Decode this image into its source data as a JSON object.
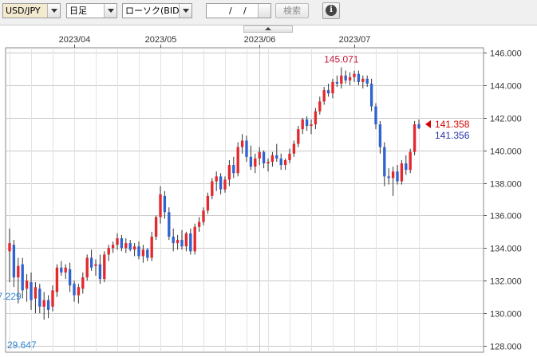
{
  "toolbar": {
    "symbol": "USD/JPY",
    "period": "日足",
    "chart_type": "ローソク(BID)",
    "date_month_sep": "/",
    "date_day_sep": "/",
    "search_label": "検索",
    "info_icon": "info-icon",
    "info_glyph": "i"
  },
  "colors": {
    "up": "#e3292e",
    "down": "#2f63d0",
    "wick": "#333333",
    "grid": "#c9c9c9",
    "high_label": "#c8193c",
    "low_label": "#2f86d1",
    "last_bid": "#d40000",
    "last_ask": "#2533a8"
  },
  "chart_data": {
    "type": "candlestick",
    "x_tick_labels": [
      "2023/04",
      "2023/05",
      "2023/06",
      "2023/07"
    ],
    "x_tick_dates": [
      "2023-04-03",
      "2023-05-01",
      "2023-06-01",
      "2023-07-03"
    ],
    "y_tick_labels": [
      "146.000",
      "144.000",
      "142.000",
      "140.000",
      "138.000",
      "136.000",
      "134.000",
      "132.000",
      "130.000",
      "128.000"
    ],
    "ylim": [
      127.6,
      146.3
    ],
    "grid": true,
    "candles": [
      {
        "o": 133.8,
        "h": 135.2,
        "l": 131.9,
        "c": 134.3
      },
      {
        "o": 134.2,
        "h": 134.5,
        "l": 131.6,
        "c": 132.2
      },
      {
        "o": 132.2,
        "h": 133.4,
        "l": 130.6,
        "c": 132.9
      },
      {
        "o": 133.0,
        "h": 133.4,
        "l": 130.9,
        "c": 131.4
      },
      {
        "o": 131.5,
        "h": 132.4,
        "l": 130.7,
        "c": 132.0
      },
      {
        "o": 131.9,
        "h": 132.5,
        "l": 130.2,
        "c": 130.8
      },
      {
        "o": 130.9,
        "h": 131.9,
        "l": 130.0,
        "c": 131.6
      },
      {
        "o": 131.5,
        "h": 131.8,
        "l": 130.0,
        "c": 130.4
      },
      {
        "o": 130.4,
        "h": 131.3,
        "l": 129.6,
        "c": 130.8
      },
      {
        "o": 130.8,
        "h": 131.1,
        "l": 129.7,
        "c": 130.2
      },
      {
        "o": 130.4,
        "h": 131.7,
        "l": 130.1,
        "c": 131.4
      },
      {
        "o": 131.3,
        "h": 133.0,
        "l": 131.0,
        "c": 132.8
      },
      {
        "o": 132.8,
        "h": 133.2,
        "l": 132.3,
        "c": 132.5
      },
      {
        "o": 132.5,
        "h": 133.0,
        "l": 132.1,
        "c": 132.8
      },
      {
        "o": 132.7,
        "h": 133.1,
        "l": 131.3,
        "c": 131.7
      },
      {
        "o": 131.8,
        "h": 132.0,
        "l": 130.7,
        "c": 131.1
      },
      {
        "o": 131.1,
        "h": 131.8,
        "l": 130.6,
        "c": 131.6
      },
      {
        "o": 131.5,
        "h": 132.5,
        "l": 131.2,
        "c": 132.2
      },
      {
        "o": 132.2,
        "h": 133.6,
        "l": 132.0,
        "c": 133.4
      },
      {
        "o": 133.4,
        "h": 133.9,
        "l": 132.6,
        "c": 132.8
      },
      {
        "o": 132.9,
        "h": 133.3,
        "l": 132.3,
        "c": 133.0
      },
      {
        "o": 133.0,
        "h": 133.6,
        "l": 131.8,
        "c": 132.1
      },
      {
        "o": 132.1,
        "h": 133.8,
        "l": 131.9,
        "c": 133.6
      },
      {
        "o": 133.6,
        "h": 134.2,
        "l": 133.2,
        "c": 134.0
      },
      {
        "o": 134.0,
        "h": 134.4,
        "l": 133.7,
        "c": 134.2
      },
      {
        "o": 134.2,
        "h": 134.9,
        "l": 133.9,
        "c": 134.6
      },
      {
        "o": 134.6,
        "h": 134.8,
        "l": 133.8,
        "c": 134.0
      },
      {
        "o": 134.0,
        "h": 134.6,
        "l": 133.7,
        "c": 134.3
      },
      {
        "o": 134.3,
        "h": 134.5,
        "l": 133.8,
        "c": 133.9
      },
      {
        "o": 133.9,
        "h": 134.3,
        "l": 133.5,
        "c": 134.1
      },
      {
        "o": 134.1,
        "h": 134.4,
        "l": 133.3,
        "c": 133.5
      },
      {
        "o": 133.5,
        "h": 134.2,
        "l": 133.1,
        "c": 133.9
      },
      {
        "o": 133.9,
        "h": 134.0,
        "l": 133.2,
        "c": 133.4
      },
      {
        "o": 133.4,
        "h": 135.0,
        "l": 133.2,
        "c": 134.7
      },
      {
        "o": 134.7,
        "h": 136.0,
        "l": 134.5,
        "c": 135.9
      },
      {
        "o": 135.9,
        "h": 137.8,
        "l": 135.5,
        "c": 137.3
      },
      {
        "o": 137.2,
        "h": 137.5,
        "l": 135.8,
        "c": 136.2
      },
      {
        "o": 136.2,
        "h": 136.5,
        "l": 134.5,
        "c": 134.7
      },
      {
        "o": 134.7,
        "h": 135.2,
        "l": 133.8,
        "c": 134.3
      },
      {
        "o": 134.3,
        "h": 134.8,
        "l": 133.9,
        "c": 134.5
      },
      {
        "o": 134.5,
        "h": 135.1,
        "l": 133.9,
        "c": 134.1
      },
      {
        "o": 134.1,
        "h": 135.0,
        "l": 133.8,
        "c": 134.9
      },
      {
        "o": 134.9,
        "h": 135.2,
        "l": 133.6,
        "c": 133.8
      },
      {
        "o": 133.8,
        "h": 135.5,
        "l": 133.6,
        "c": 135.3
      },
      {
        "o": 135.3,
        "h": 135.9,
        "l": 135.0,
        "c": 135.6
      },
      {
        "o": 135.6,
        "h": 136.5,
        "l": 135.4,
        "c": 136.3
      },
      {
        "o": 136.3,
        "h": 137.4,
        "l": 136.1,
        "c": 137.2
      },
      {
        "o": 137.2,
        "h": 138.3,
        "l": 137.0,
        "c": 138.1
      },
      {
        "o": 138.1,
        "h": 138.7,
        "l": 137.5,
        "c": 138.4
      },
      {
        "o": 138.4,
        "h": 138.6,
        "l": 137.3,
        "c": 137.6
      },
      {
        "o": 137.6,
        "h": 138.4,
        "l": 137.4,
        "c": 138.2
      },
      {
        "o": 138.2,
        "h": 139.4,
        "l": 137.8,
        "c": 139.1
      },
      {
        "o": 139.1,
        "h": 139.6,
        "l": 138.3,
        "c": 138.6
      },
      {
        "o": 138.6,
        "h": 140.5,
        "l": 138.4,
        "c": 140.2
      },
      {
        "o": 140.2,
        "h": 141.0,
        "l": 139.8,
        "c": 140.6
      },
      {
        "o": 140.6,
        "h": 140.9,
        "l": 139.3,
        "c": 139.6
      },
      {
        "o": 139.6,
        "h": 140.3,
        "l": 138.8,
        "c": 139.0
      },
      {
        "o": 139.0,
        "h": 139.8,
        "l": 138.6,
        "c": 139.5
      },
      {
        "o": 139.5,
        "h": 140.2,
        "l": 139.1,
        "c": 139.9
      },
      {
        "o": 139.9,
        "h": 140.0,
        "l": 138.9,
        "c": 139.2
      },
      {
        "o": 139.2,
        "h": 139.5,
        "l": 138.7,
        "c": 139.3
      },
      {
        "o": 139.3,
        "h": 139.9,
        "l": 139.0,
        "c": 139.7
      },
      {
        "o": 139.7,
        "h": 140.4,
        "l": 139.3,
        "c": 139.5
      },
      {
        "o": 139.5,
        "h": 139.8,
        "l": 138.8,
        "c": 139.1
      },
      {
        "o": 139.1,
        "h": 139.5,
        "l": 138.8,
        "c": 139.4
      },
      {
        "o": 139.4,
        "h": 140.1,
        "l": 139.2,
        "c": 139.8
      },
      {
        "o": 139.8,
        "h": 140.6,
        "l": 139.6,
        "c": 140.4
      },
      {
        "o": 140.4,
        "h": 141.5,
        "l": 140.2,
        "c": 141.3
      },
      {
        "o": 141.3,
        "h": 142.0,
        "l": 141.0,
        "c": 141.9
      },
      {
        "o": 141.9,
        "h": 142.1,
        "l": 141.2,
        "c": 141.5
      },
      {
        "o": 141.5,
        "h": 141.9,
        "l": 141.0,
        "c": 141.6
      },
      {
        "o": 141.6,
        "h": 142.6,
        "l": 141.3,
        "c": 142.4
      },
      {
        "o": 142.4,
        "h": 143.3,
        "l": 142.2,
        "c": 143.0
      },
      {
        "o": 143.0,
        "h": 143.9,
        "l": 142.8,
        "c": 143.7
      },
      {
        "o": 143.7,
        "h": 144.1,
        "l": 143.3,
        "c": 143.5
      },
      {
        "o": 143.5,
        "h": 144.4,
        "l": 143.2,
        "c": 144.2
      },
      {
        "o": 144.2,
        "h": 144.6,
        "l": 143.9,
        "c": 144.1
      },
      {
        "o": 144.1,
        "h": 145.1,
        "l": 143.8,
        "c": 144.6
      },
      {
        "o": 144.6,
        "h": 144.9,
        "l": 144.1,
        "c": 144.3
      },
      {
        "o": 144.3,
        "h": 144.8,
        "l": 144.0,
        "c": 144.5
      },
      {
        "o": 144.5,
        "h": 144.9,
        "l": 144.2,
        "c": 144.7
      },
      {
        "o": 144.7,
        "h": 144.9,
        "l": 144.0,
        "c": 144.2
      },
      {
        "o": 144.2,
        "h": 144.6,
        "l": 143.8,
        "c": 144.4
      },
      {
        "o": 144.4,
        "h": 144.6,
        "l": 143.9,
        "c": 144.1
      },
      {
        "o": 144.1,
        "h": 144.4,
        "l": 142.4,
        "c": 142.7
      },
      {
        "o": 142.7,
        "h": 142.9,
        "l": 141.3,
        "c": 141.6
      },
      {
        "o": 141.6,
        "h": 141.8,
        "l": 139.8,
        "c": 140.2
      },
      {
        "o": 140.2,
        "h": 140.5,
        "l": 137.8,
        "c": 138.4
      },
      {
        "o": 138.4,
        "h": 138.9,
        "l": 137.9,
        "c": 138.3
      },
      {
        "o": 138.3,
        "h": 139.0,
        "l": 137.2,
        "c": 138.7
      },
      {
        "o": 138.7,
        "h": 139.1,
        "l": 137.9,
        "c": 138.1
      },
      {
        "o": 138.1,
        "h": 139.4,
        "l": 137.9,
        "c": 139.2
      },
      {
        "o": 139.2,
        "h": 139.7,
        "l": 138.5,
        "c": 138.8
      },
      {
        "o": 138.8,
        "h": 140.1,
        "l": 138.6,
        "c": 139.9
      },
      {
        "o": 139.9,
        "h": 141.8,
        "l": 139.7,
        "c": 141.6
      },
      {
        "o": 141.6,
        "h": 141.9,
        "l": 141.3,
        "c": 141.36
      }
    ],
    "high_label": "145.071",
    "low_label": "137.229",
    "left_low_label": "29.647",
    "last_bid": "141.358",
    "last_ask": "141.356"
  }
}
